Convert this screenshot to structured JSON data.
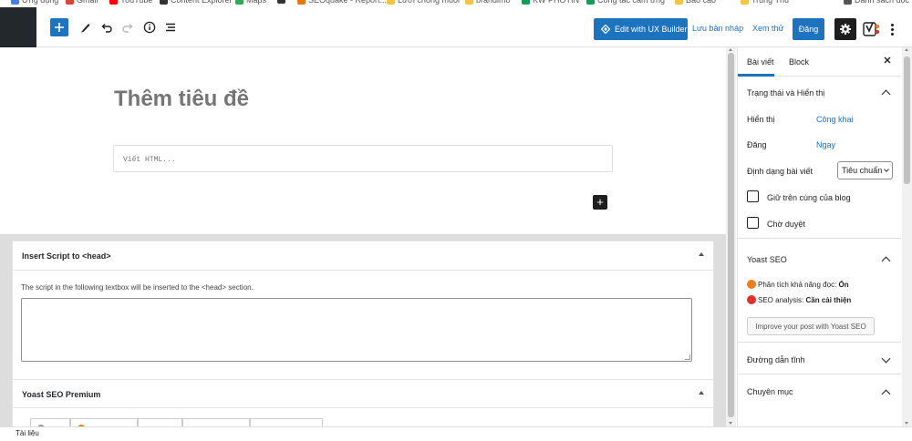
{
  "bookmarks": [
    {
      "label": "Ứng dụng",
      "color": "#4a7fd6"
    },
    {
      "label": "Gmail",
      "color": "#d44638"
    },
    {
      "label": "YouTube",
      "color": "#ff0000"
    },
    {
      "label": "Content Explorer",
      "color": "#333333"
    },
    {
      "label": "Maps",
      "color": "#34a853"
    },
    {
      "label": "",
      "color": "#333333"
    },
    {
      "label": "SEOquake - Report...",
      "color": "#e8740c"
    },
    {
      "label": "Lưới chống muỗi",
      "color": "#f3c544"
    },
    {
      "label": "brandimo",
      "color": "#f3c544"
    },
    {
      "label": "KW PHOTIN",
      "color": "#0f9d58"
    },
    {
      "label": "Công tác cảm ứng",
      "color": "#0f9d58"
    },
    {
      "label": "Báo cáo",
      "color": "#f3c544"
    },
    {
      "label": "Trung Thu",
      "color": "#f3c544"
    },
    {
      "label": "Danh sách đọc",
      "color": "#555555"
    }
  ],
  "toolbar": {
    "ux_builder_label": "Edit with UX Builder",
    "save_draft_label": "Lưu bản nháp",
    "preview_label": "Xem thử",
    "publish_label": "Đăng",
    "accent_color": "#1e73be"
  },
  "editor": {
    "title_placeholder": "Thêm tiêu đề",
    "html_placeholder": "Viết HTML..."
  },
  "metaboxes": {
    "insert_script": {
      "title": "Insert Script to <head>",
      "description": "The script in the following textbox will be inserted to the <head> section."
    },
    "yoast_premium": {
      "title": "Yoast SEO Premium"
    }
  },
  "sidebar": {
    "tab_post": "Bài viết",
    "tab_block": "Block",
    "status_section": {
      "title": "Trạng thái và Hiển thị",
      "visibility_label": "Hiển thị",
      "visibility_value": "Công khai",
      "publish_label": "Đăng",
      "publish_value": "Ngay",
      "format_label": "Định dạng bài viết",
      "format_value": "Tiêu chuẩn",
      "sticky_label": "Giữ trên cùng của blog",
      "pending_label": "Chờ duyệt"
    },
    "yoast_section": {
      "title": "Yoast SEO",
      "readability_label": "Phân tích khả năng đọc:",
      "readability_value": "Ổn",
      "readability_color": "#ee7c1b",
      "seo_label": "SEO analysis:",
      "seo_value": "Cần cải thiện",
      "seo_color": "#dc3232",
      "improve_button": "Improve your post with Yoast SEO"
    },
    "permalink_title": "Đường dẫn tĩnh",
    "category_title": "Chuyên mục"
  },
  "footer": {
    "label": "Tài liệu"
  }
}
